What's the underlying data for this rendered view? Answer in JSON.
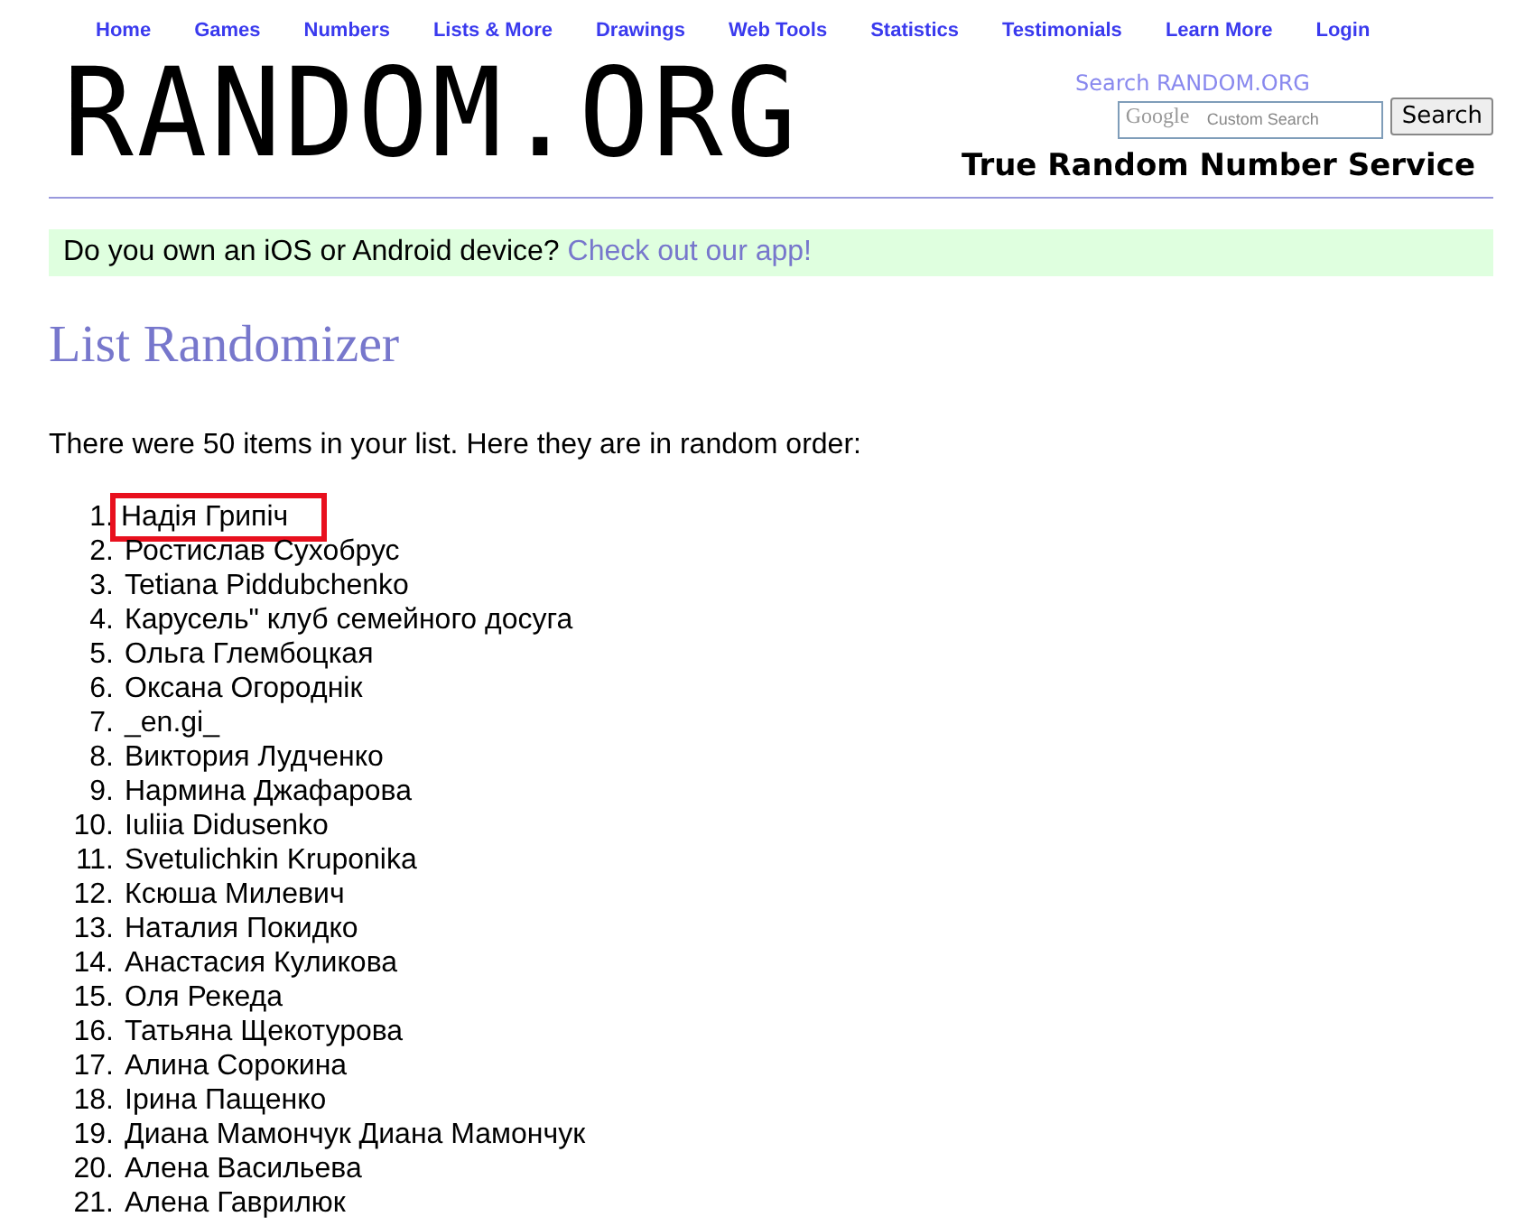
{
  "nav": [
    "Home",
    "Games",
    "Numbers",
    "Lists & More",
    "Drawings",
    "Web Tools",
    "Statistics",
    "Testimonials",
    "Learn More",
    "Login"
  ],
  "logo": "RANDOM.ORG",
  "search": {
    "label": "Search RANDOM.ORG",
    "brand": "Google",
    "placeholder": "Custom Search",
    "button": "Search"
  },
  "tagline": "True Random Number Service",
  "banner": {
    "text": "Do you own an iOS or Android device?",
    "link": "Check out our app!"
  },
  "title": "List Randomizer",
  "intro": "There were 50 items in your list. Here they are in random order:",
  "items": [
    {
      "number": "1.",
      "text": "Надія Грипіч",
      "highlighted": true
    },
    {
      "number": "2.",
      "text": "Ростислав Сухобрус",
      "highlighted": false
    },
    {
      "number": "3.",
      "text": "Tetiana Piddubchenko",
      "highlighted": false
    },
    {
      "number": "4.",
      "text": "Карусель\" клуб семейного досуга",
      "highlighted": false
    },
    {
      "number": "5.",
      "text": "Ольга Глембоцкая",
      "highlighted": false
    },
    {
      "number": "6.",
      "text": "Оксана Огороднік",
      "highlighted": false
    },
    {
      "number": "7.",
      "text": "_en.gi_",
      "highlighted": false
    },
    {
      "number": "8.",
      "text": "Виктория Лудченко",
      "highlighted": false
    },
    {
      "number": "9.",
      "text": "Нармина Джафарова",
      "highlighted": false
    },
    {
      "number": "10.",
      "text": "Iuliia Didusenko",
      "highlighted": false
    },
    {
      "number": "11.",
      "text": "Svetulichkin Kruponika",
      "highlighted": false
    },
    {
      "number": "12.",
      "text": "Ксюша Милевич",
      "highlighted": false
    },
    {
      "number": "13.",
      "text": "Наталия Покидко",
      "highlighted": false
    },
    {
      "number": "14.",
      "text": "Анастасия Куликова",
      "highlighted": false
    },
    {
      "number": "15.",
      "text": "Оля Рекеда",
      "highlighted": false
    },
    {
      "number": "16.",
      "text": "Татьяна Щекотурова",
      "highlighted": false
    },
    {
      "number": "17.",
      "text": "Алина Сорокина",
      "highlighted": false
    },
    {
      "number": "18.",
      "text": "Ірина Пащенко",
      "highlighted": false
    },
    {
      "number": "19.",
      "text": "Диана Мамончук Диана Мамончук",
      "highlighted": false
    },
    {
      "number": "20.",
      "text": "Алена Васильева",
      "highlighted": false
    },
    {
      "number": "21.",
      "text": "Алена Гаврилюк",
      "highlighted": false
    }
  ]
}
